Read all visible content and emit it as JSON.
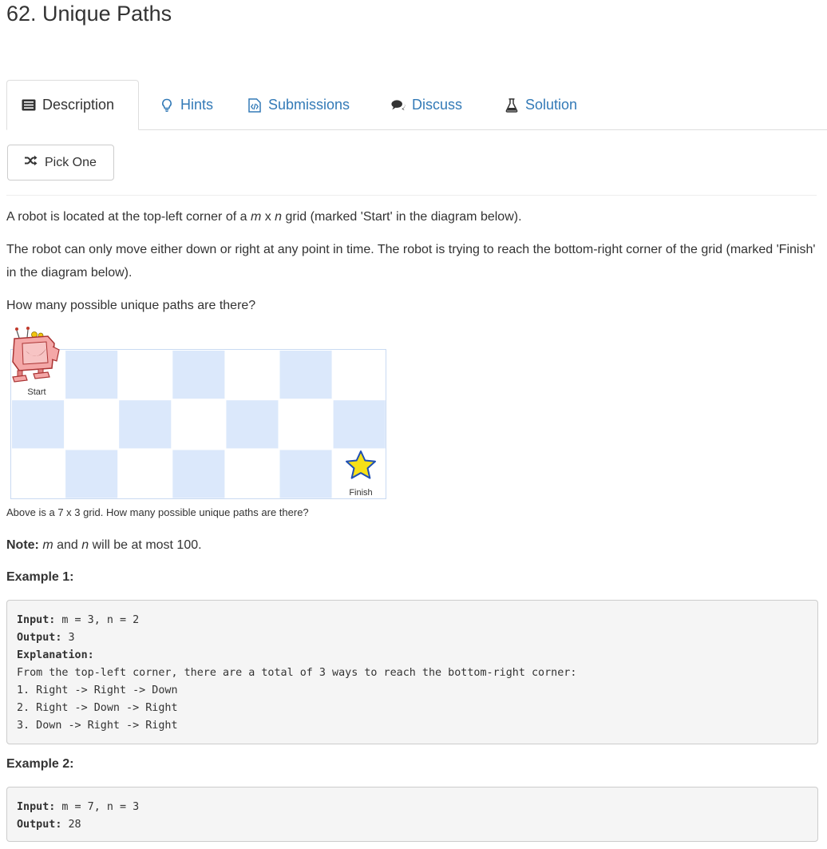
{
  "problem": {
    "title": "62. Unique Paths"
  },
  "tabs": [
    {
      "label": "Description",
      "icon": "list-icon"
    },
    {
      "label": "Hints",
      "icon": "lightbulb-icon"
    },
    {
      "label": "Submissions",
      "icon": "code-file-icon"
    },
    {
      "label": "Discuss",
      "icon": "chat-icon"
    },
    {
      "label": "Solution",
      "icon": "flask-icon"
    }
  ],
  "pick_one": {
    "label": "Pick One",
    "icon": "shuffle-icon"
  },
  "description": {
    "p1_before": "A robot is located at the top-left corner of a ",
    "m": "m",
    "x": " x ",
    "n": "n",
    "p1_after": " grid (marked 'Start' in the diagram below).",
    "p2": "The robot can only move either down or right at any point in time. The robot is trying to reach the bottom-right corner of the grid (marked 'Finish' in the diagram below).",
    "p3": "How many possible unique paths are there?"
  },
  "diagram": {
    "start_label": "Start",
    "finish_label": "Finish",
    "columns": 7,
    "rows": 3,
    "light_color": "#dbe8fb",
    "caption": "Above is a 7 x 3 grid. How many possible unique paths are there?"
  },
  "note": {
    "label": "Note:",
    "m": "m",
    "and": " and ",
    "n": "n",
    "rest": " will be at most 100."
  },
  "example1": {
    "heading": "Example 1:",
    "input_label": "Input:",
    "input_value": " m = 3, n = 2",
    "output_label": "Output:",
    "output_value": " 3",
    "explanation_label": "Explanation:",
    "lines": [
      "From the top-left corner, there are a total of 3 ways to reach the bottom-right corner:",
      "1. Right -> Right -> Down",
      "2. Right -> Down -> Right",
      "3. Down -> Right -> Right"
    ]
  },
  "example2": {
    "heading": "Example 2:",
    "input_label": "Input:",
    "input_value": " m = 7, n = 3",
    "output_label": "Output:",
    "output_value": " 28"
  }
}
